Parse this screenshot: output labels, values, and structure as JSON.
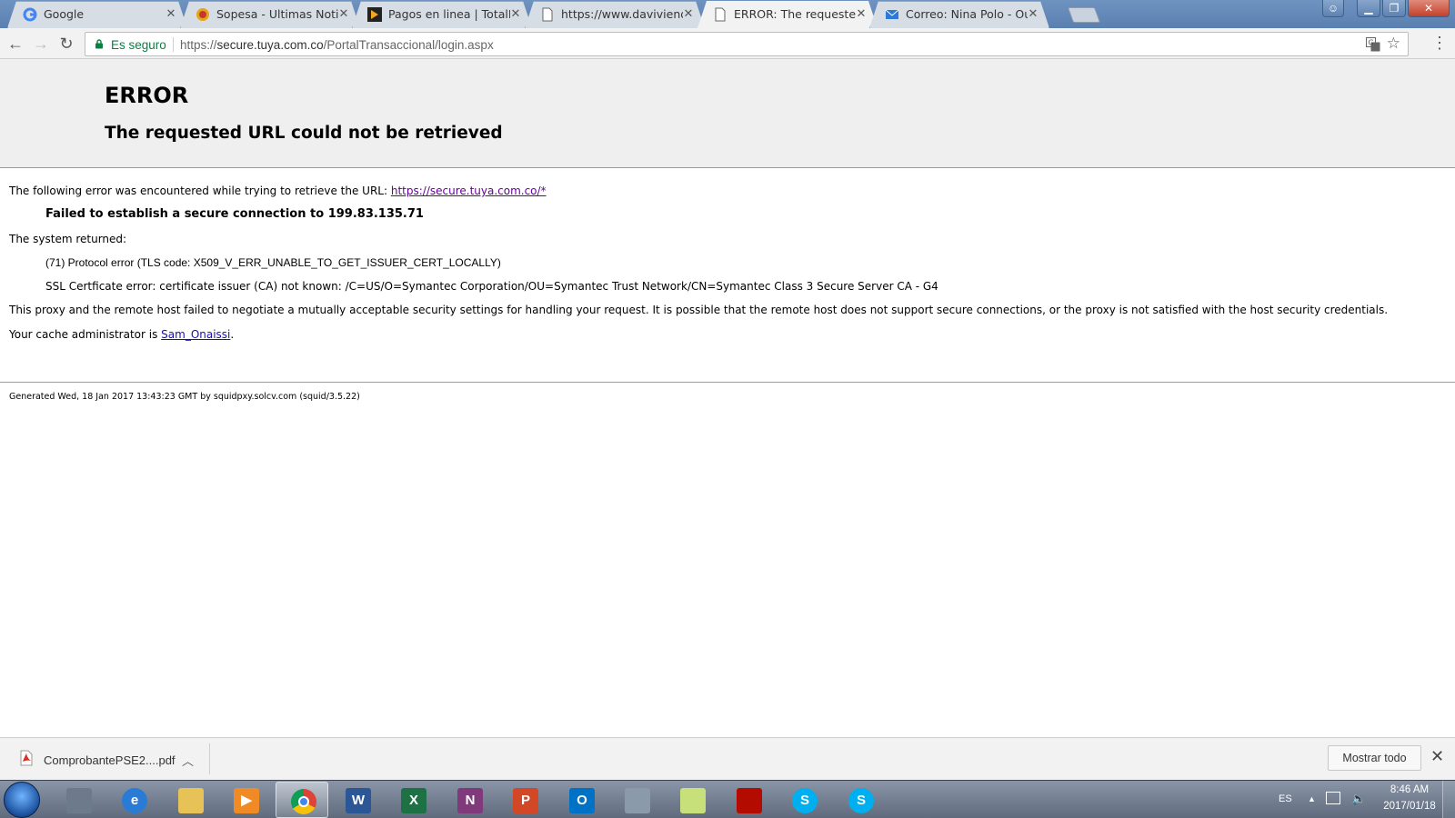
{
  "browser": {
    "tabs": [
      {
        "title": "Google",
        "icon": "google-icon",
        "active": false
      },
      {
        "title": "Sopesa - Ultimas Noticias",
        "icon": "sopesa-icon",
        "active": false
      },
      {
        "title": "Pagos en linea | TotalPlay",
        "icon": "totalplay-icon",
        "active": false
      },
      {
        "title": "https://www.davivienda.com",
        "icon": "page-icon",
        "active": false
      },
      {
        "title": "ERROR: The requested URL",
        "icon": "page-icon",
        "active": true
      },
      {
        "title": "Correo: Nina Polo - Outlook",
        "icon": "mail-icon",
        "active": false
      }
    ],
    "secure_label": "Es seguro",
    "url_scheme": "https://",
    "url_host": "secure.tuya.com.co",
    "url_path": "/PortalTransaccional/login.aspx"
  },
  "page": {
    "title": "ERROR",
    "subtitle": "The requested URL could not be retrieved",
    "intro_text": "The following error was encountered while trying to retrieve the URL: ",
    "intro_link": "https://secure.tuya.com.co/*",
    "error_bold": "Failed to establish a secure connection to 199.83.135.71",
    "system_returned": "The system returned:",
    "protocol_error": "(71) Protocol error (TLS code: X509_V_ERR_UNABLE_TO_GET_ISSUER_CERT_LOCALLY)",
    "ssl_error": "SSL Certficate error: certificate issuer (CA) not known: /C=US/O=Symantec Corporation/OU=Symantec Trust Network/CN=Symantec Class 3 Secure Server CA - G4",
    "proxy_text": "This proxy and the remote host failed to negotiate a mutually acceptable security settings for handling your request. It is possible that the remote host does not support secure connections, or the proxy is not satisfied with the host security credentials.",
    "admin_prefix": "Your cache administrator is ",
    "admin_link": "Sam_Onaissi",
    "admin_suffix": ".",
    "footer": "Generated Wed, 18 Jan 2017 13:43:23 GMT by squidpxy.solcv.com (squid/3.5.22)"
  },
  "download_bar": {
    "file_name": "ComprobantePSE2....pdf",
    "show_all_label": "Mostrar todo"
  },
  "taskbar": {
    "apps": [
      {
        "name": "zend-studio",
        "label": "",
        "color": "#6d7a8c",
        "active": false
      },
      {
        "name": "internet-explorer",
        "label": "e",
        "color": "#2a7bd5",
        "active": false
      },
      {
        "name": "file-explorer",
        "label": "",
        "color": "#e7c257",
        "active": false
      },
      {
        "name": "media-player",
        "label": "▶",
        "color": "#f08a24",
        "active": false
      },
      {
        "name": "chrome",
        "label": "",
        "color": "#dd4b39",
        "active": true
      },
      {
        "name": "word",
        "label": "W",
        "color": "#2b5797",
        "active": false
      },
      {
        "name": "excel",
        "label": "X",
        "color": "#1e7145",
        "active": false
      },
      {
        "name": "onenote",
        "label": "N",
        "color": "#80397b",
        "active": false
      },
      {
        "name": "powerpoint",
        "label": "P",
        "color": "#d24726",
        "active": false
      },
      {
        "name": "outlook",
        "label": "O",
        "color": "#0072c6",
        "active": false
      },
      {
        "name": "calculator",
        "label": "",
        "color": "#8b9aab",
        "active": false
      },
      {
        "name": "sticky-notes",
        "label": "",
        "color": "#c8e07a",
        "active": false
      },
      {
        "name": "acrobat",
        "label": "",
        "color": "#b30b00",
        "active": false
      },
      {
        "name": "skype",
        "label": "S",
        "color": "#00aff0",
        "active": false
      },
      {
        "name": "skype-business",
        "label": "S",
        "color": "#00aff0",
        "active": false
      }
    ],
    "language": "ES",
    "time": "8:46 AM",
    "date": "2017/01/18"
  },
  "colors": {
    "secure_green": "#0b8043",
    "link_blue": "#1a0dab",
    "link_visited": "#660099"
  }
}
